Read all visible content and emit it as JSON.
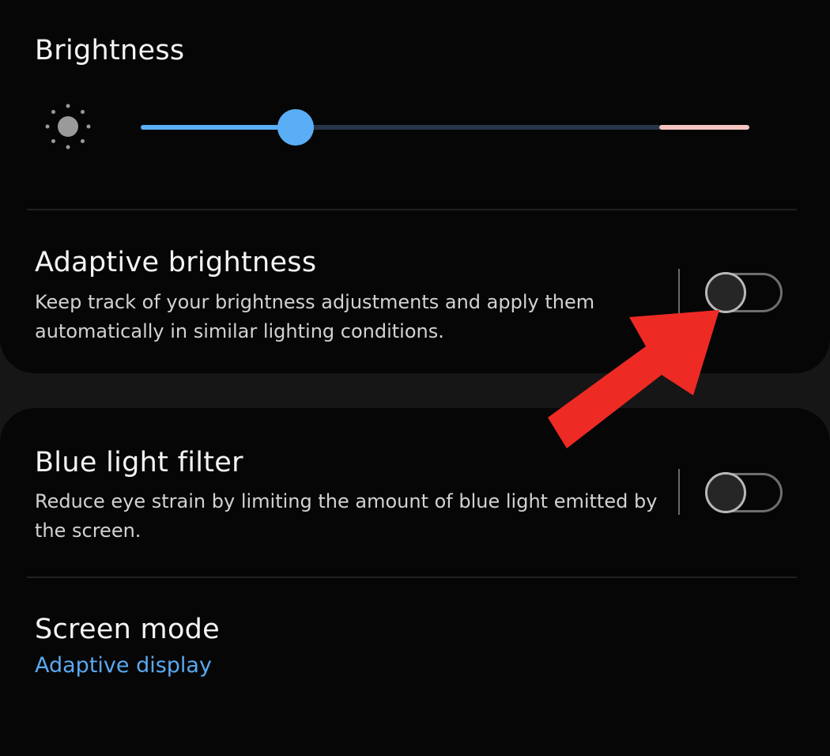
{
  "colors": {
    "accent": "#5aaef5",
    "track_inactive": "#26364a",
    "track_high": "#f3c4c0",
    "annotation_arrow": "#ee2a24",
    "background": "#060606"
  },
  "brightness": {
    "title": "Brightness",
    "icon": "sun-icon",
    "level": 0.24
  },
  "adaptive_brightness": {
    "title": "Adaptive brightness",
    "description": "Keep track of your brightness adjustments and apply them automatically in similar lighting conditions.",
    "enabled": false
  },
  "blue_light_filter": {
    "title": "Blue light filter",
    "description": "Reduce eye strain by limiting the amount of blue light emitted by the screen.",
    "enabled": false
  },
  "screen_mode": {
    "title": "Screen mode",
    "value": "Adaptive display"
  },
  "annotation": {
    "icon": "red-arrow-icon",
    "points_to": "adaptive_brightness toggle"
  }
}
